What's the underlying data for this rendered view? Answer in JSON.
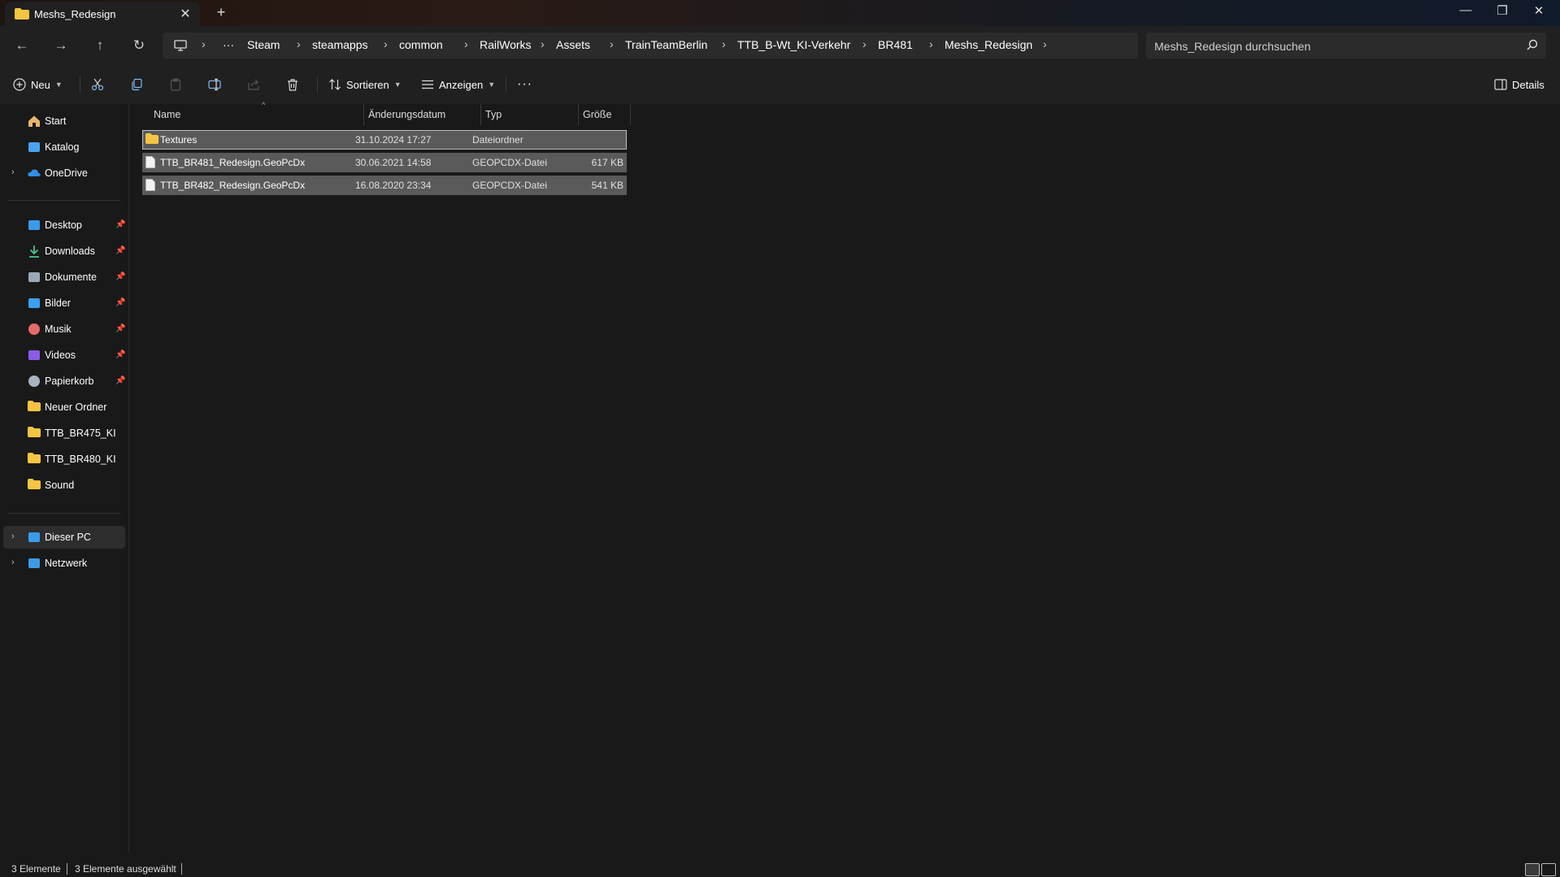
{
  "window": {
    "tab_title": "Meshs_Redesign",
    "tab_close": "✕",
    "new_tab": "+",
    "minimize": "—",
    "maximize": "❐",
    "close": "✕"
  },
  "nav": {
    "back": "←",
    "forward": "→",
    "up": "↑",
    "refresh": "↻",
    "more_crumbs": "···",
    "breadcrumbs": [
      "Steam",
      "steamapps",
      "common",
      "RailWorks",
      "Assets",
      "TrainTeamBerlin",
      "TTB_B-Wt_KI-Verkehr",
      "BR481",
      "Meshs_Redesign"
    ],
    "separator": "›",
    "search_placeholder": "Meshs_Redesign durchsuchen"
  },
  "commands": {
    "new_label": "Neu",
    "sort_label": "Sortieren",
    "view_label": "Anzeigen",
    "more": "···",
    "details_label": "Details"
  },
  "sidebar": {
    "top": [
      {
        "label": "Start",
        "icon": "home-icon"
      },
      {
        "label": "Katalog",
        "icon": "gallery-icon"
      },
      {
        "label": "OneDrive",
        "icon": "cloud-icon"
      }
    ],
    "quick": [
      {
        "label": "Desktop",
        "icon": "desktop-icon",
        "pinned": true
      },
      {
        "label": "Downloads",
        "icon": "download-icon",
        "pinned": true
      },
      {
        "label": "Dokumente",
        "icon": "document-icon",
        "pinned": true
      },
      {
        "label": "Bilder",
        "icon": "pictures-icon",
        "pinned": true
      },
      {
        "label": "Musik",
        "icon": "music-icon",
        "pinned": true
      },
      {
        "label": "Videos",
        "icon": "video-icon",
        "pinned": true
      },
      {
        "label": "Papierkorb",
        "icon": "recycle-bin-icon",
        "pinned": true
      },
      {
        "label": "Neuer Ordner",
        "icon": "folder-icon",
        "pinned": false
      },
      {
        "label": "TTB_BR475_KI",
        "icon": "folder-icon",
        "pinned": false
      },
      {
        "label": "TTB_BR480_KI",
        "icon": "folder-icon",
        "pinned": false
      },
      {
        "label": "Sound",
        "icon": "folder-icon",
        "pinned": false
      }
    ],
    "bottom": [
      {
        "label": "Dieser PC",
        "icon": "pc-icon"
      },
      {
        "label": "Netzwerk",
        "icon": "network-icon"
      }
    ],
    "pin_glyph": "📌",
    "expand_glyph": "›"
  },
  "files": {
    "columns": [
      "Name",
      "Änderungsdatum",
      "Typ",
      "Größe"
    ],
    "rows": [
      {
        "name": "Textures",
        "date": "31.10.2024 17:27",
        "type": "Dateiordner",
        "size": "",
        "icon": "folder-icon"
      },
      {
        "name": "TTB_BR481_Redesign.GeoPcDx",
        "date": "30.06.2021 14:58",
        "type": "GEOPCDX-Datei",
        "size": "617 KB",
        "icon": "file-icon"
      },
      {
        "name": "TTB_BR482_Redesign.GeoPcDx",
        "date": "16.08.2020 23:34",
        "type": "GEOPCDX-Datei",
        "size": "541 KB",
        "icon": "file-icon"
      }
    ]
  },
  "status": {
    "count": "3 Elemente",
    "selected": "3 Elemente ausgewählt"
  },
  "colors": {
    "folder": "#f4c542",
    "accent": "#4aa3f0",
    "selection": "#5a5a5a"
  }
}
